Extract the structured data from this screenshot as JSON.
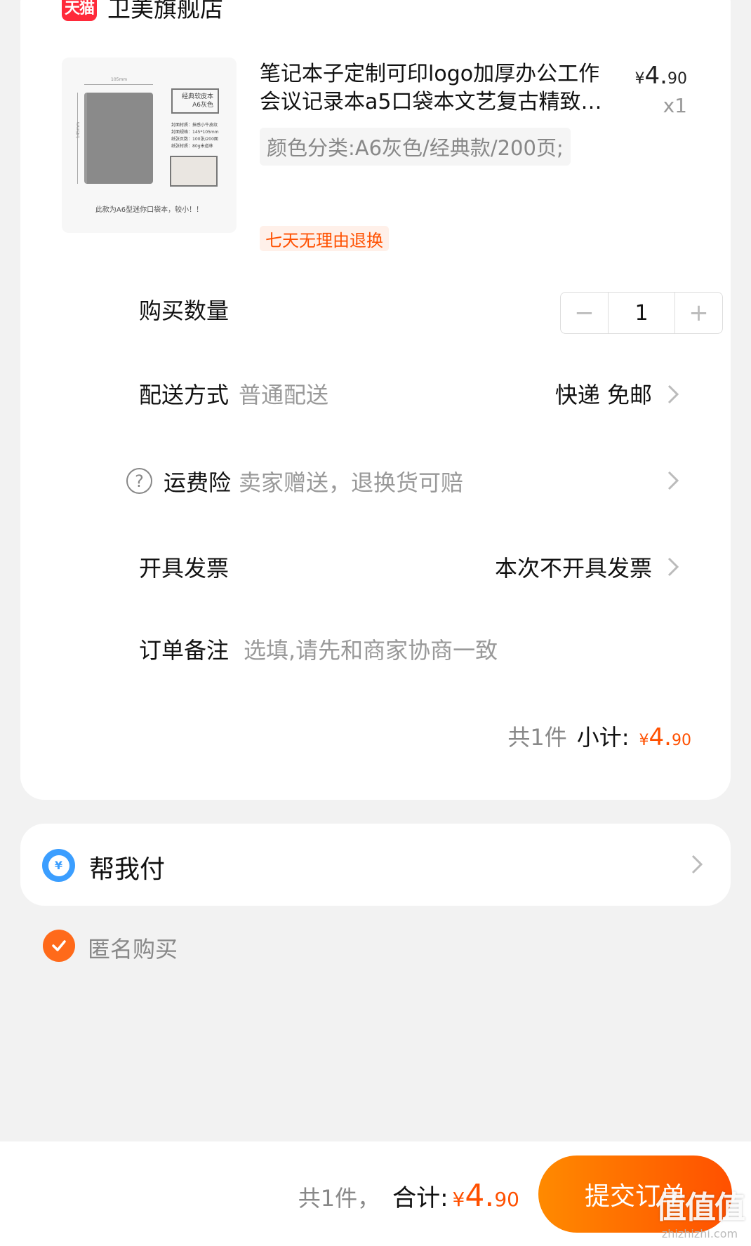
{
  "shop": {
    "logo_text": "天猫",
    "name": "卫美旗舰店"
  },
  "product": {
    "image_dim_top": "105mm",
    "image_dim_left": "145mm",
    "image_box_line1": "经典软皮本",
    "image_box_line2": "A6灰色",
    "image_spec_lines": [
      "封面材质：抹感小牛皮纹",
      "封面规格：145*105mm",
      "纸张页数：100张/200面",
      "纸张材质：80g米道林"
    ],
    "image_caption": "此款为A6型迷你口袋本，较小！！",
    "title_line1": "笔记本子定制可印logo加厚办公工作",
    "title_line2": "会议记录本a5口袋本文艺复古精致…",
    "price_symbol": "¥",
    "price_int": "4.",
    "price_dec": "90",
    "quantity_label": "x1",
    "sku": "颜色分类:A6灰色/经典款/200页;",
    "return_tag": "七天无理由退换"
  },
  "rows": {
    "quantity_label": "购买数量",
    "quantity_value": "1",
    "minus": "−",
    "plus": "+",
    "delivery_label": "配送方式",
    "delivery_value": "普通配送",
    "delivery_right": "快递 免邮",
    "insurance_icon": "?",
    "insurance_label": "运费险",
    "insurance_value": "卖家赠送，退换货可赔",
    "invoice_label": "开具发票",
    "invoice_right": "本次不开具发票",
    "note_label": "订单备注",
    "note_placeholder": "选填,请先和商家协商一致"
  },
  "subtotal": {
    "count": "共1件",
    "label": "小计:",
    "symbol": "¥",
    "int": "4.",
    "dec": "90"
  },
  "pay_for_me": {
    "icon_text": "¥",
    "label": "帮我付"
  },
  "anonymous": {
    "label": "匿名购买",
    "checked": true
  },
  "bottom": {
    "count": "共1件，",
    "label": "合计:",
    "symbol": "¥",
    "int": "4.",
    "dec": "90",
    "submit_label": "提交订单"
  },
  "watermark": {
    "main": "值值值",
    "sub": "zhizhizhi.com"
  },
  "colors": {
    "accent": "#ff5000",
    "tmall_red": "#ff2a3a",
    "pay_blue": "#3b9eff"
  }
}
